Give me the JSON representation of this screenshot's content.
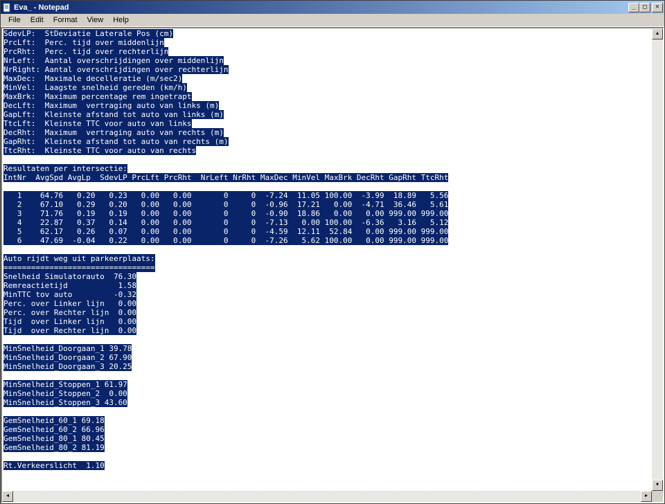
{
  "window": {
    "title": "Eva_ - Notepad"
  },
  "menu": {
    "file": "File",
    "edit": "Edit",
    "format": "Format",
    "view": "View",
    "help": "Help"
  },
  "winbtn": {
    "minimize": "_",
    "maximize": "□",
    "close": "✕"
  },
  "scroll": {
    "up": "▴",
    "down": "▾",
    "left": "◂",
    "right": "▸"
  },
  "defs": [
    "SdevLP:  StDeviatie Laterale Pos (cm)",
    "PrcLft:  Perc. tijd over middenlijn",
    "PrcRht:  Perc. tijd over rechterlijn",
    "NrLeft:  Aantal overschrijdingen over middenlijn",
    "NrRight: Aantal overschrijdingen over rechterlijn",
    "MaxDec:  Maximale decelleratie (m/sec2)",
    "MinVel:  Laagste snelheid gereden (km/h)",
    "MaxBrk:  Maximum percentage rem ingetrapt",
    "DecLft:  Maximum  vertraging auto van links (m)",
    "GapLft:  Kleinste afstand tot auto van links (m)",
    "TtcLft:  Kleinste TTC voor auto van links",
    "DecRht:  Maximum  vertraging auto van rechts (m)",
    "GapRht:  Kleinste afstand tot auto van rechts (m)",
    "TtcRht:  Kleinste TTC voor auto van rechts"
  ],
  "section1_title": "Resultaten per intersectie:",
  "table": {
    "header": "IntNr  AvgSpd AvgLp  SdevLP PrcLft PrcRht  NrLeft NrRht MaxDec MinVel MaxBrk DecRht GapRht TtcRht",
    "rows": [
      "   1    64.76   0.20   0.23   0.00   0.00       0     0  -7.24  11.05 100.00  -3.99  18.89   5.56",
      "   2    67.10   0.29   0.20   0.00   0.00       0     0  -0.96  17.21   0.00  -4.71  36.46   5.61",
      "   3    71.76   0.19   0.19   0.00   0.00       0     0  -0.90  18.86   0.00   0.00 999.00 999.00",
      "   4    22.87   0.37   0.14   0.00   0.00       0     0  -7.13   0.00 100.00  -6.36   3.16   5.12",
      "   5    62.17   0.26   0.07   0.00   0.00       0     0  -4.59  12.11  52.84   0.00 999.00 999.00",
      "   6    47.69  -0.04   0.22   0.00   0.00       0     0  -7.26   5.62 100.00   0.00 999.00 999.00"
    ]
  },
  "section2_title": "Auto rijdt weg uit parkeerplaats:",
  "section2_divider": "=================================",
  "parking": [
    "Snelheid Simulatorauto  76.30",
    "Remreactietijd           1.58",
    "MinTTC tov auto         -0.32",
    "Perc. over Linker lijn   0.00",
    "Perc. over Rechter lijn  0.00",
    "Tijd  over Linker lijn   0.00",
    "Tijd  over Rechter lijn  0.00"
  ],
  "minspeed_go": [
    "MinSnelheid_Doorgaan_1 39.78",
    "MinSnelheid_Doorgaan_2 67.90",
    "MinSnelheid_Doorgaan_3 20.25"
  ],
  "minspeed_stop": [
    "MinSnelheid_Stoppen_1 61.97",
    "MinSnelheid_Stoppen_2  0.00",
    "MinSnelheid_Stoppen_3 43.60"
  ],
  "avgspeed": [
    "GemSnelheid_60_1 69.18",
    "GemSnelheid_60_2 66.96",
    "GemSnelheid_80_1 80.45",
    "GemSnelheid_80_2 81.19"
  ],
  "traffic_light": "Rt.Verkeerslicht  1.10"
}
